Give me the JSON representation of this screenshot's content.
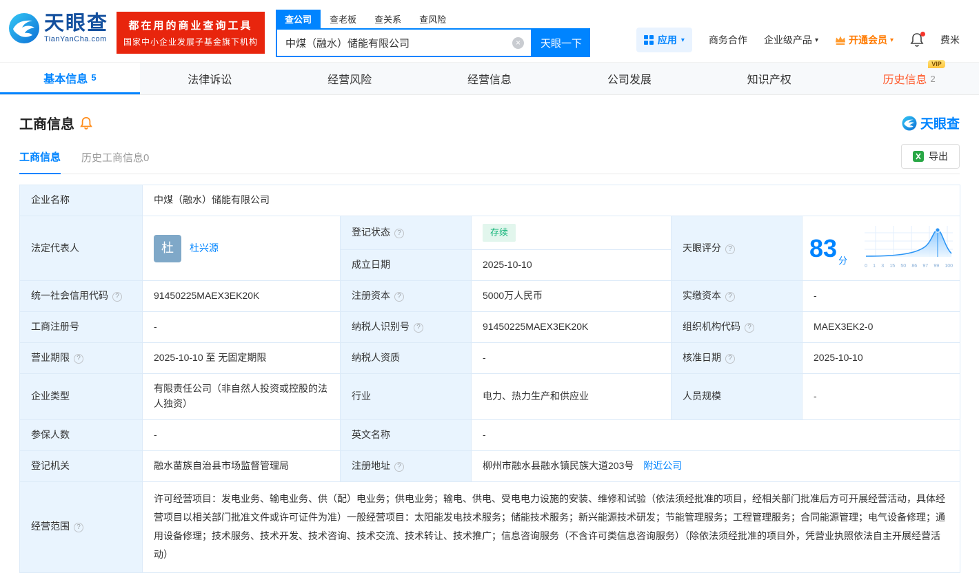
{
  "icons": {
    "help": "?",
    "caret": "▾",
    "clear": "×"
  },
  "colors": {
    "primary": "#0084ff",
    "label_bg": "#e9f4fe",
    "status_green": "#0bb275",
    "history_orange": "#ff5b2d",
    "banner_red": "#e8250d",
    "vip_orange": "#ff7a00"
  },
  "header": {
    "logo": {
      "name": "天眼查",
      "domain": "TianYanCha.com"
    },
    "banner": {
      "line1": "都在用的商业查询工具",
      "line2": "国家中小企业发展子基金旗下机构"
    },
    "search": {
      "tabs": [
        {
          "label": "查公司"
        },
        {
          "label": "查老板"
        },
        {
          "label": "查关系"
        },
        {
          "label": "查风险"
        }
      ],
      "value": "中煤（融水）储能有限公司",
      "submit": "天眼一下"
    },
    "menu": {
      "apps": "应用",
      "cooperation": "商务合作",
      "enterprise": "企业级产品",
      "vip": "开通会员",
      "user": "费米"
    }
  },
  "nav_tabs": [
    {
      "label": "基本信息",
      "count": "5"
    },
    {
      "label": "法律诉讼"
    },
    {
      "label": "经营风险"
    },
    {
      "label": "经营信息"
    },
    {
      "label": "公司发展"
    },
    {
      "label": "知识产权"
    },
    {
      "label": "历史信息",
      "count": "2",
      "badge": "VIP"
    }
  ],
  "section": {
    "title": "工商信息",
    "brand": "天眼查",
    "subtabs": [
      {
        "label": "工商信息"
      },
      {
        "label": "历史工商信息0"
      }
    ],
    "export": "导出"
  },
  "fields": {
    "company_name": {
      "label": "企业名称",
      "value": "中煤（融水）储能有限公司"
    },
    "legal_rep": {
      "label": "法定代表人",
      "avatar": "杜",
      "value": "杜兴源"
    },
    "reg_status": {
      "label": "登记状态",
      "value": "存续"
    },
    "establish_date": {
      "label": "成立日期",
      "value": "2025-10-10"
    },
    "score": {
      "label": "天眼评分",
      "value": "83",
      "unit": "分",
      "axis": "0 1 3 15 50 86 97 99 100"
    },
    "credit_code": {
      "label": "统一社会信用代码",
      "value": "91450225MAEX3EK20K"
    },
    "reg_capital": {
      "label": "注册资本",
      "value": "5000万人民币"
    },
    "paid_capital": {
      "label": "实缴资本",
      "value": "-"
    },
    "reg_no": {
      "label": "工商注册号",
      "value": "-"
    },
    "taxpayer_id": {
      "label": "纳税人识别号",
      "value": "91450225MAEX3EK20K"
    },
    "org_code": {
      "label": "组织机构代码",
      "value": "MAEX3EK2-0"
    },
    "term": {
      "label": "营业期限",
      "value": "2025-10-10 至 无固定期限"
    },
    "taxpayer_quality": {
      "label": "纳税人资质",
      "value": "-"
    },
    "approve_date": {
      "label": "核准日期",
      "value": "2025-10-10"
    },
    "company_type": {
      "label": "企业类型",
      "value": "有限责任公司（非自然人投资或控股的法人独资）"
    },
    "industry": {
      "label": "行业",
      "value": "电力、热力生产和供应业"
    },
    "staff_size": {
      "label": "人员规模",
      "value": "-"
    },
    "insured": {
      "label": "参保人数",
      "value": "-"
    },
    "english_name": {
      "label": "英文名称",
      "value": "-"
    },
    "authority": {
      "label": "登记机关",
      "value": "融水苗族自治县市场监督管理局"
    },
    "address": {
      "label": "注册地址",
      "value": "柳州市融水县融水镇民族大道203号",
      "link": "附近公司"
    },
    "scope": {
      "label": "经营范围",
      "value": "许可经营项目：发电业务、输电业务、供（配）电业务；供电业务；输电、供电、受电电力设施的安装、维修和试验（依法须经批准的项目，经相关部门批准后方可开展经营活动，具体经营项目以相关部门批准文件或许可证件为准）一般经营项目：太阳能发电技术服务；储能技术服务；新兴能源技术研发；节能管理服务；工程管理服务；合同能源管理；电气设备修理；通用设备修理；技术服务、技术开发、技术咨询、技术交流、技术转让、技术推广；信息咨询服务（不含许可类信息咨询服务）（除依法须经批准的项目外，凭营业执照依法自主开展经营活动）"
    }
  }
}
